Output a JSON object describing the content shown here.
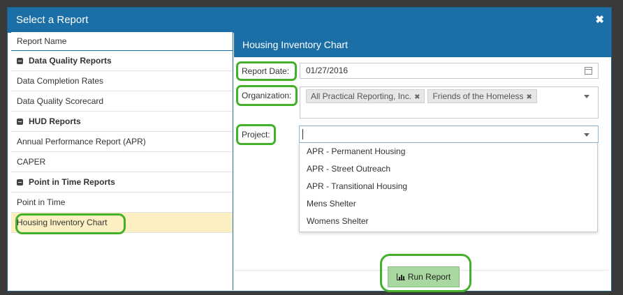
{
  "modal": {
    "title": "Select a Report",
    "close_icon": "close-icon"
  },
  "report_list": {
    "header": "Report Name",
    "groups": [
      {
        "label": "Data Quality Reports",
        "items": [
          "Data Completion Rates",
          "Data Quality Scorecard"
        ]
      },
      {
        "label": "HUD Reports",
        "items": [
          "Annual Performance Report (APR)",
          "CAPER"
        ]
      },
      {
        "label": "Point in Time Reports",
        "items": [
          "Point in Time",
          "Housing Inventory Chart"
        ]
      }
    ],
    "selected": "Housing Inventory Chart"
  },
  "panel": {
    "title": "Housing Inventory Chart",
    "report_date_label": "Report Date:",
    "report_date_value": "01/27/2016",
    "organization_label": "Organization:",
    "organizations": [
      "All Practical Reporting, Inc.",
      "Friends of the Homeless"
    ],
    "project_label": "Project:",
    "project_value": "",
    "project_options": [
      "APR - Permanent Housing",
      "APR - Street Outreach",
      "APR - Transitional Housing",
      "Mens Shelter",
      "Womens Shelter"
    ],
    "run_label": "Run Report"
  },
  "colors": {
    "header_blue": "#1b6fa6",
    "selected_row": "#fcf0c3",
    "highlight_green": "#43b02a",
    "run_button": "#a9d7a0"
  }
}
